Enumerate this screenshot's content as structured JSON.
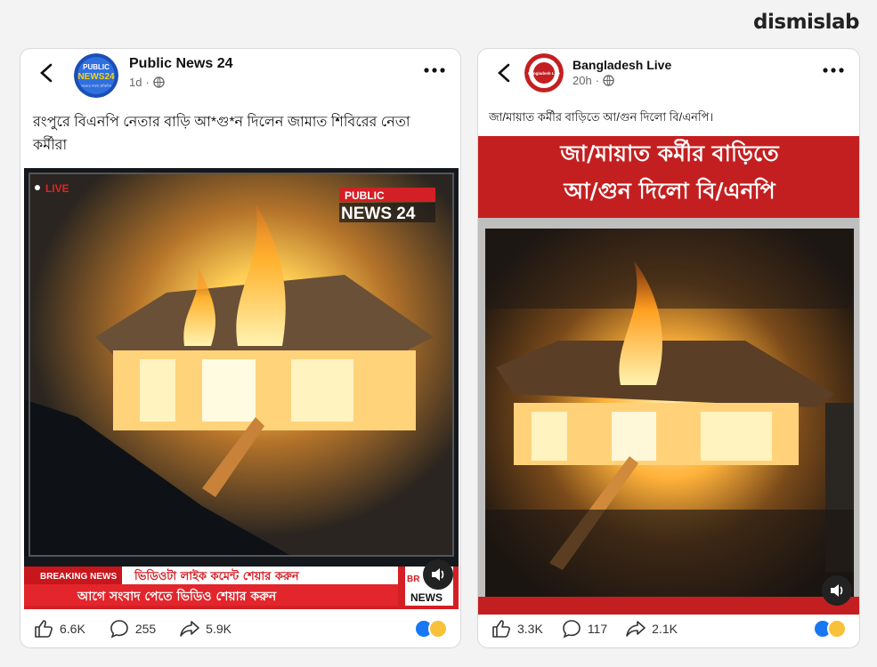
{
  "brand": {
    "name": "dismislab"
  },
  "posts": [
    {
      "page_name": "Public News 24",
      "time": "1d",
      "caption": "রংপুরে বিএনপি নেতার বাড়ি আ*গু*ন দিলেন জামাত শিবিরের নেতা কর্মীরা",
      "avatar_text": {
        "line1": "PUBLIC",
        "line2": "NEWS24",
        "line3": "সত্যের সাথে প্রতিদিন"
      },
      "video": {
        "live_label": "LIVE",
        "logo_top": "PUBLIC",
        "logo_bottom": "NEWS 24",
        "breaking_label": "BREAKING NEWS",
        "ticker_top": "ভিডিওটা লাইক কমেন্ট শেয়ার করুন",
        "ticker_bottom": "আগে সংবাদ পেতে ভিডিও শেয়ার করুন",
        "corner_badge_top": "BR",
        "corner_badge_bottom": "NEWS"
      },
      "stats": {
        "likes": "6.6K",
        "comments": "255",
        "shares": "5.9K"
      }
    },
    {
      "page_name": "Bangladesh Live",
      "time": "20h",
      "caption": "জা/মায়াত কর্মীর বাড়িতে আ/গুন দিলো বি/এনপি।",
      "avatar_text": {
        "line1": "Bangladesh Live"
      },
      "video": {
        "banner_line1": "জা/মায়াত কর্মীর বাড়িতে",
        "banner_line2": "আ/গুন দিলো বি/এনপি"
      },
      "stats": {
        "likes": "3.3K",
        "comments": "117",
        "shares": "2.1K"
      }
    }
  ],
  "colors": {
    "fb_blue": "#1877f2",
    "news_red": "#c41f20",
    "fire": "#ffb03a"
  }
}
